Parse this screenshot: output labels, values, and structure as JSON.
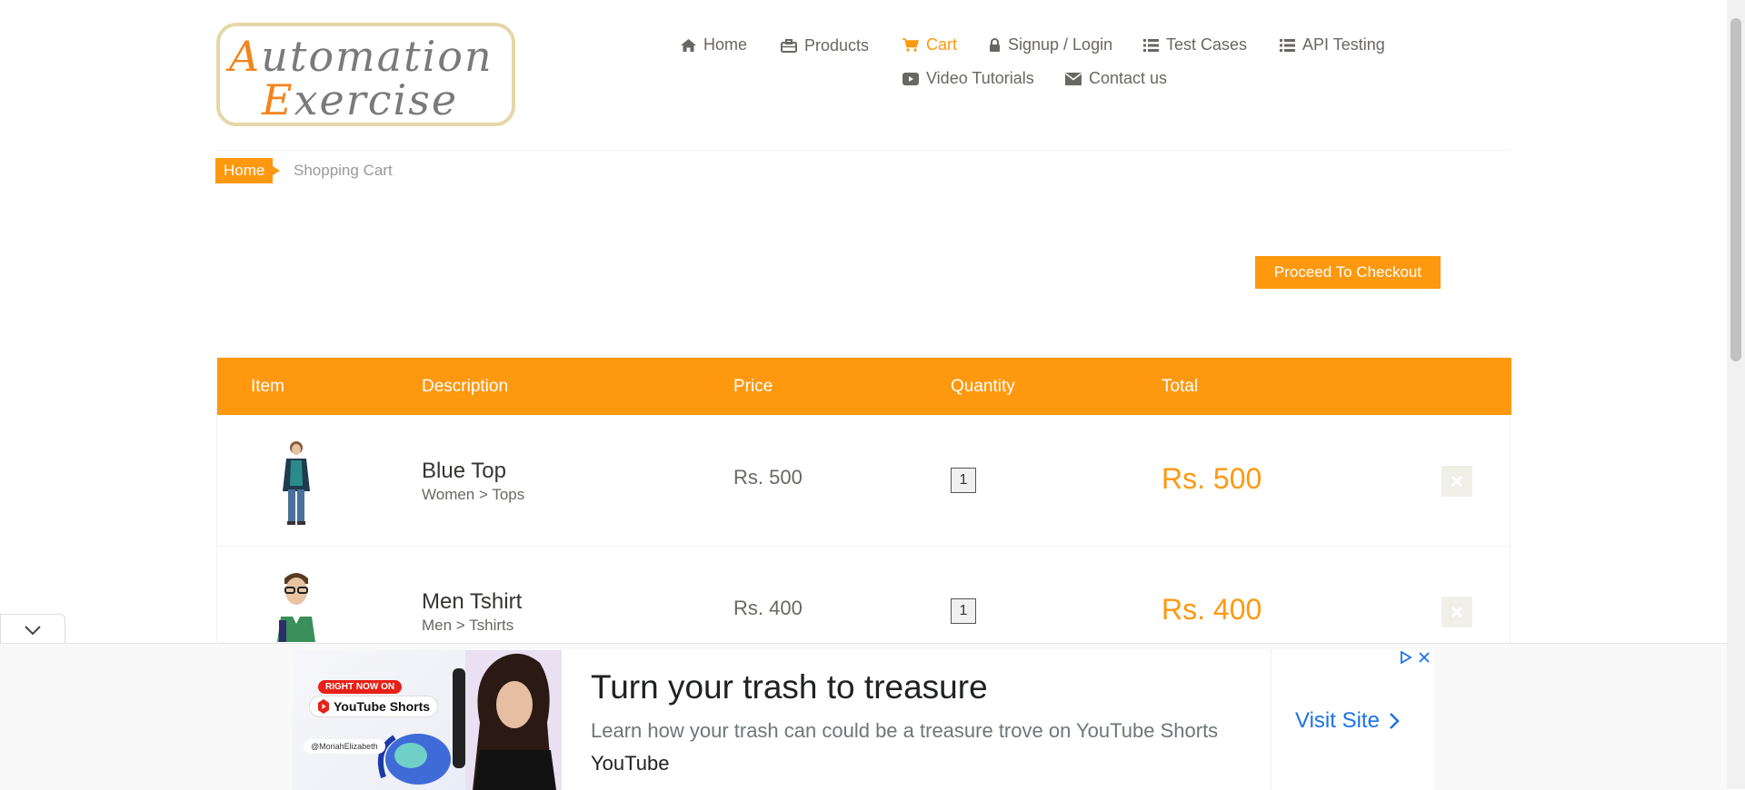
{
  "logo": {
    "line1_cap": "A",
    "line1_rest": "utomation",
    "line2_cap": "E",
    "line2_rest": "xercise"
  },
  "nav": {
    "home": "Home",
    "products": "Products",
    "cart": "Cart",
    "signup": "Signup / Login",
    "test_cases": "Test Cases",
    "api_testing": "API Testing",
    "video_tutorials": "Video Tutorials",
    "contact": "Contact us"
  },
  "breadcrumb": {
    "home": "Home",
    "current": "Shopping Cart"
  },
  "checkout_button": "Proceed To Checkout",
  "table": {
    "headers": [
      "Item",
      "Description",
      "Price",
      "Quantity",
      "Total"
    ],
    "rows": [
      {
        "name": "Blue Top",
        "category": "Women > Tops",
        "price": "Rs. 500",
        "quantity": "1",
        "total": "Rs. 500"
      },
      {
        "name": "Men Tshirt",
        "category": "Men > Tshirts",
        "price": "Rs. 400",
        "quantity": "1",
        "total": "Rs. 400"
      }
    ]
  },
  "ad": {
    "badge_top": "RIGHT NOW ON",
    "badge_brand": "YouTube Shorts",
    "handle": "@MoriahElizabeth",
    "title": "Turn your trash to treasure",
    "description": "Learn how your trash can could be a treasure trove on YouTube Shorts",
    "brand": "YouTube",
    "cta": "Visit Site"
  },
  "colors": {
    "accent": "#fe980f",
    "text": "#696763",
    "link": "#1a73e8"
  }
}
